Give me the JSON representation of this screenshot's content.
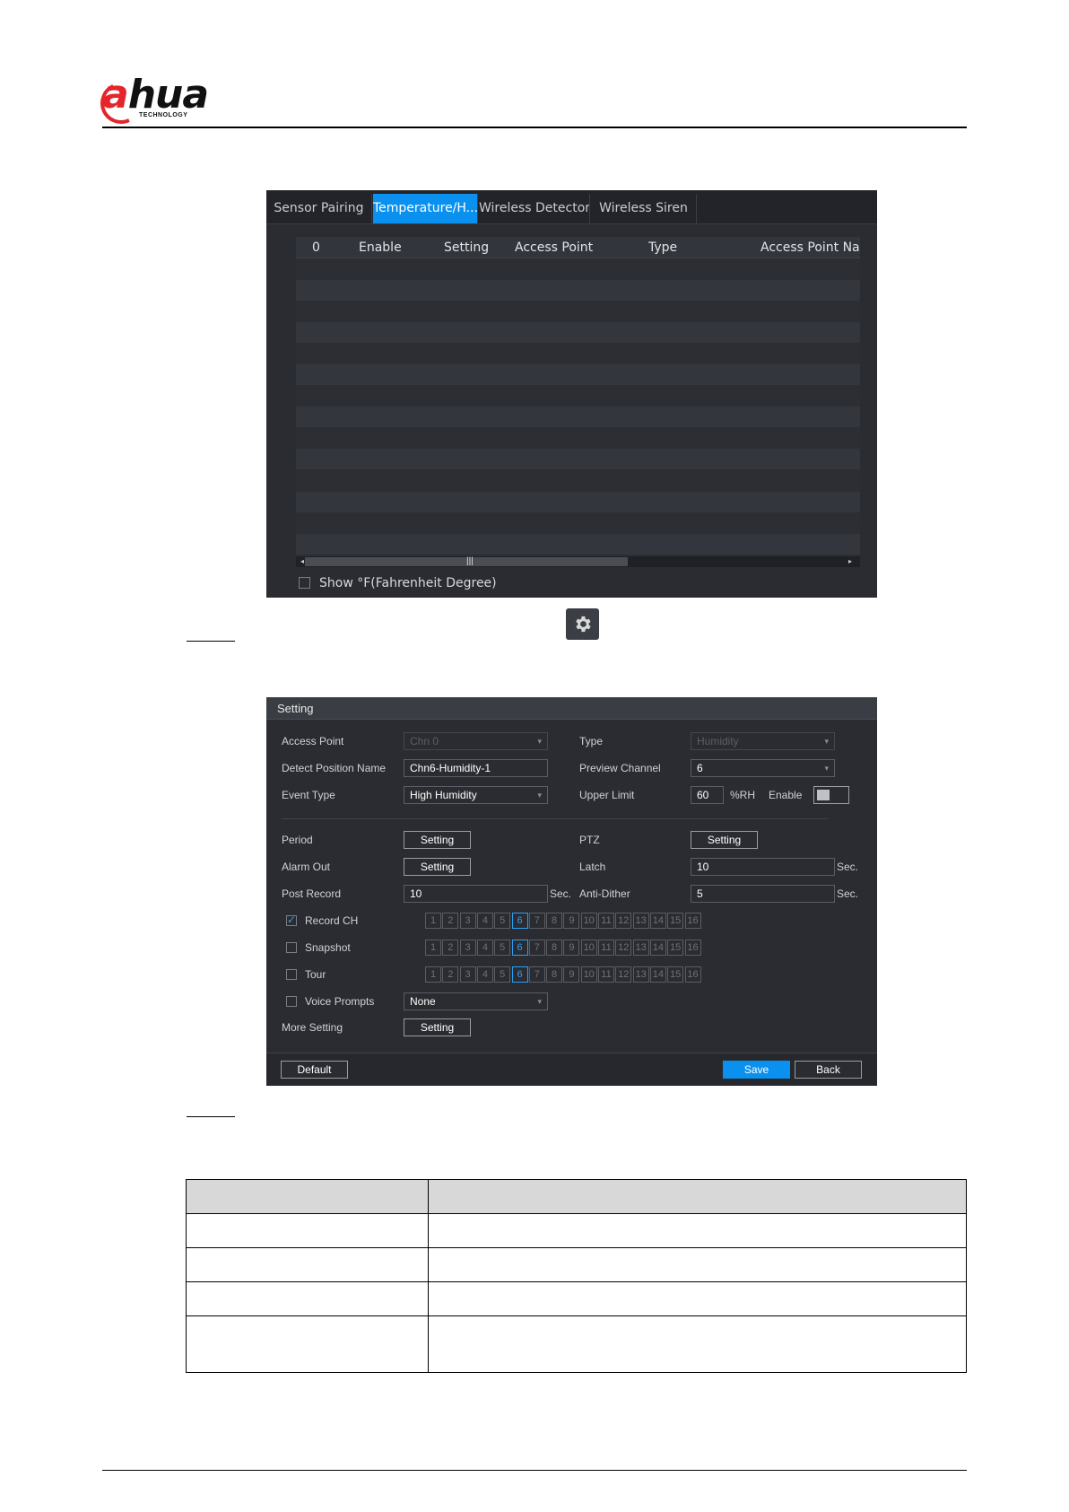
{
  "brand": {
    "logo_text_a": "a",
    "logo_text_rest": "hua",
    "logo_sub": "TECHNOLOGY",
    "accent": "#e4262c"
  },
  "sensor_list": {
    "tabs": [
      "Sensor Pairing",
      "Temperature/H...",
      "Wireless Detector",
      "Wireless Siren"
    ],
    "active_tab": 1,
    "columns": [
      "0",
      "Enable",
      "Setting",
      "Access Point",
      "Type",
      "Access Point Nam"
    ],
    "show_fahrenheit_label": "Show °F(Fahrenheit Degree)",
    "scroll_grip": "|||",
    "scroll_left": "◂",
    "scroll_right": "▸"
  },
  "gear_icon": "gear-icon",
  "setting_dialog": {
    "title": "Setting",
    "access_point": {
      "label": "Access Point",
      "value": "Chn 0",
      "disabled": true
    },
    "type": {
      "label": "Type",
      "value": "Humidity",
      "disabled": true
    },
    "detect_position_name": {
      "label": "Detect Position Name",
      "value": "Chn6-Humidity-1"
    },
    "preview_channel": {
      "label": "Preview Channel",
      "value": "6"
    },
    "event_type": {
      "label": "Event Type",
      "value": "High Humidity"
    },
    "upper_limit": {
      "label": "Upper Limit",
      "value": "60",
      "unit": "%RH"
    },
    "enable_label": "Enable",
    "period": {
      "label": "Period",
      "button": "Setting"
    },
    "ptz": {
      "label": "PTZ",
      "button": "Setting"
    },
    "alarm_out": {
      "label": "Alarm Out",
      "button": "Setting"
    },
    "latch": {
      "label": "Latch",
      "value": "10",
      "unit": "Sec."
    },
    "post_record": {
      "label": "Post Record",
      "value": "10",
      "unit": "Sec."
    },
    "anti_dither": {
      "label": "Anti-Dither",
      "value": "5",
      "unit": "Sec."
    },
    "record_ch": {
      "label": "Record CH",
      "checked": true
    },
    "snapshot": {
      "label": "Snapshot",
      "checked": false
    },
    "tour": {
      "label": "Tour",
      "checked": false
    },
    "channels": [
      "1",
      "2",
      "3",
      "4",
      "5",
      "6",
      "7",
      "8",
      "9",
      "10",
      "11",
      "12",
      "13",
      "14",
      "15",
      "16"
    ],
    "selected_channel": "6",
    "voice_prompts": {
      "label": "Voice Prompts",
      "value": "None",
      "checked": false
    },
    "more_setting": {
      "label": "More Setting",
      "button": "Setting"
    },
    "default_button": "Default",
    "save_button": "Save",
    "back_button": "Back"
  },
  "dropdown_arrow": "▾"
}
